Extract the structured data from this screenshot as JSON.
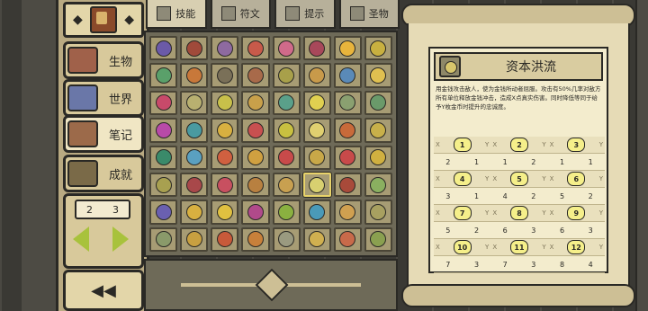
{
  "sidebar": {
    "items": [
      {
        "label": "生物",
        "color": "#a0614a"
      },
      {
        "label": "世界",
        "color": "#6a77a8"
      },
      {
        "label": "笔记",
        "color": "#9c6a4a",
        "active": true
      },
      {
        "label": "成就",
        "color": "#7a6a48"
      }
    ],
    "page": {
      "current": "2",
      "total": "3"
    }
  },
  "tabs": [
    {
      "label": "技能",
      "active": true
    },
    {
      "label": "符文"
    },
    {
      "label": "提示"
    },
    {
      "label": "圣物"
    }
  ],
  "grid": {
    "icon_colors": [
      "#6b5aa8",
      "#a04a3a",
      "#8e6aa0",
      "#c85a4a",
      "#d06a8a",
      "#a8485a",
      "#e8b43c",
      "#c8b040",
      "#5aa06a",
      "#c8783a",
      "#7a7058",
      "#a86a4a",
      "#a8a04a",
      "#c89a4a",
      "#5a8ab8",
      "#e0c050",
      "#c84a6a",
      "#b8b070",
      "#c8c04a",
      "#c8a04a",
      "#5aa08a",
      "#e0d050",
      "#8aa070",
      "#6a9a6a",
      "#b84aa8",
      "#4a9aa0",
      "#d8b040",
      "#c85050",
      "#c8c040",
      "#e0d070",
      "#c86a3a",
      "#c8b04a",
      "#3a8a6a",
      "#5aa0c0",
      "#d06040",
      "#d0a040",
      "#c84a4a",
      "#c8a848",
      "#c84a4a",
      "#d0b040",
      "#a8a050",
      "#a8484a",
      "#c85060",
      "#b88040",
      "#c8a050",
      "#d8d070",
      "#a84a3a",
      "#8ab060",
      "#6a60b0",
      "#d8b040",
      "#e0c040",
      "#b04a8a",
      "#8ab040",
      "#4a9ab8",
      "#d0a050",
      "#a8a060",
      "#8a9a6a",
      "#c8a040",
      "#c85a3a",
      "#c8803a",
      "#9a9a80",
      "#d0b050",
      "#c86a4a",
      "#8aa050"
    ],
    "selected_index": 45
  },
  "detail": {
    "title": "资本洪流",
    "description": "用金钱攻击敌人，使为金钱所动者屈服。攻击有50%几率对敌方所有单位释放金钱冲击，造成X点真实伤害。同时降低等同于给予Y枚金币时提升的忠诚度。",
    "levels": [
      {
        "num": "1",
        "x": "2",
        "y": "1"
      },
      {
        "num": "2",
        "x": "1",
        "y": "2"
      },
      {
        "num": "3",
        "x": "1",
        "y": "1"
      },
      {
        "num": "4",
        "x": "3",
        "y": "1"
      },
      {
        "num": "5",
        "x": "4",
        "y": "2"
      },
      {
        "num": "6",
        "x": "5",
        "y": "2"
      },
      {
        "num": "7",
        "x": "5",
        "y": "2"
      },
      {
        "num": "8",
        "x": "6",
        "y": "3"
      },
      {
        "num": "9",
        "x": "6",
        "y": "3"
      },
      {
        "num": "10",
        "x": "7",
        "y": "3"
      },
      {
        "num": "11",
        "x": "7",
        "y": "3"
      },
      {
        "num": "12",
        "x": "8",
        "y": "4"
      }
    ]
  }
}
